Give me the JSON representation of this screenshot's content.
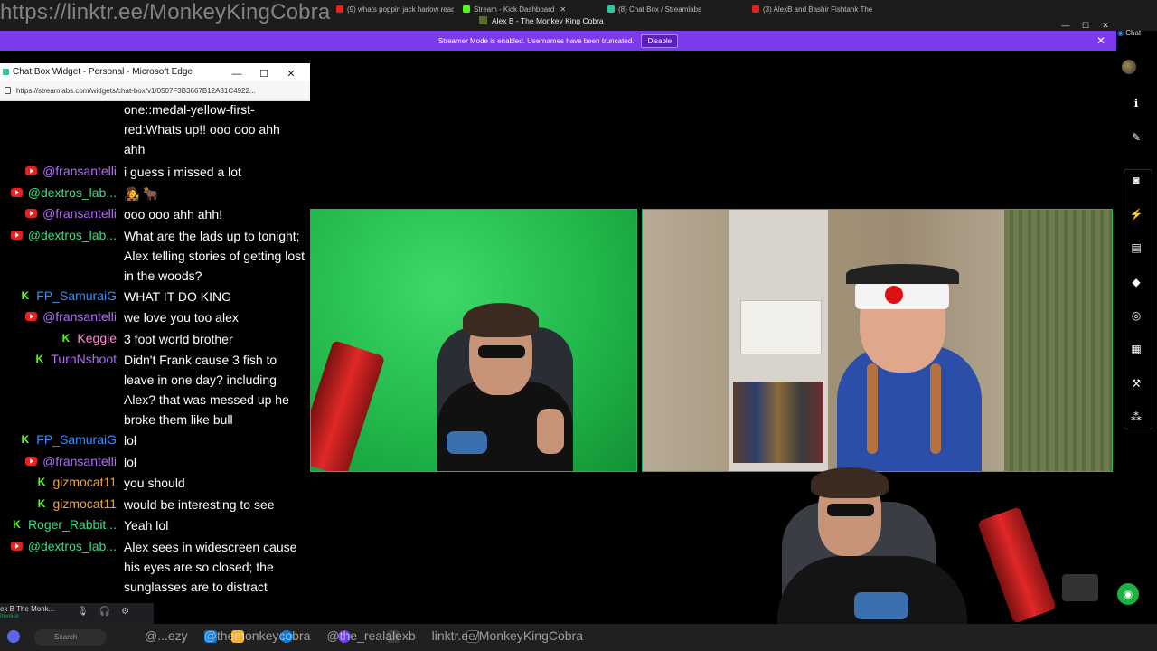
{
  "browser": {
    "overlay_link": "https://linktr.ee/MonkeyKingCobra",
    "window_title": "Alex B - The Monkey King Cobra",
    "tabs": [
      {
        "label": "(9) whats poppin jack harlow reac",
        "color": "#e52222"
      },
      {
        "label": "Stream - Kick Dashboard",
        "color": "#53fc18"
      },
      {
        "label": "(8) Chat Box / Streamlabs",
        "color": "#31c3a2"
      },
      {
        "label": "(3) AlexB and Bashir Fishtank The",
        "color": "#e52222"
      }
    ],
    "edge_chat_label": "Chat"
  },
  "banner": {
    "text": "Streamer Mode is enabled. Usernames have been truncated.",
    "disable_label": "Disable",
    "close_glyph": "✕"
  },
  "chat_window": {
    "title": "Chat Box Widget - Personal - Microsoft Edge",
    "url": "https://streamlabs.com/widgets/chat-box/v1/0507F3B3667B12A31C4922...",
    "controls": [
      "—",
      "☐",
      "✕"
    ]
  },
  "chat": {
    "messages": [
      {
        "platform": "youtube",
        "name": "",
        "name_color": "#b36bff",
        "text": "one::medal-yellow-first-red:Whats up!! ooo ooo ahh ahh"
      },
      {
        "platform": "youtube",
        "name": "@fransantelli",
        "name_color": "#b36bff",
        "text": "i guess i missed a lot"
      },
      {
        "platform": "youtube",
        "name": "@dextros_lab...",
        "name_color": "#3ddc84",
        "text": "🧑‍🎤 🐂"
      },
      {
        "platform": "youtube",
        "name": "@fransantelli",
        "name_color": "#b36bff",
        "text": "ooo ooo ahh ahh!"
      },
      {
        "platform": "youtube",
        "name": "@dextros_lab...",
        "name_color": "#3ddc84",
        "text": "What are the lads up to tonight; Alex telling stories of getting lost in the woods?"
      },
      {
        "platform": "kick",
        "name": "FP_SamuraiG",
        "name_color": "#3a8dff",
        "text": "WHAT IT DO KING"
      },
      {
        "platform": "youtube",
        "name": "@fransantelli",
        "name_color": "#b36bff",
        "text": "we love you too alex"
      },
      {
        "platform": "kick",
        "name": "Keggie",
        "name_color": "#ff8ad8",
        "text": "3 foot world brother"
      },
      {
        "platform": "kick",
        "name": "TurnNshoot",
        "name_color": "#b36bff",
        "text": "Didn't Frank cause 3 fish to leave in one day? including Alex? that was messed up he broke them like bull"
      },
      {
        "platform": "kick",
        "name": "FP_SamuraiG",
        "name_color": "#3a8dff",
        "text": "lol"
      },
      {
        "platform": "youtube",
        "name": "@fransantelli",
        "name_color": "#b36bff",
        "text": "lol"
      },
      {
        "platform": "kick",
        "name": "gizmocat11",
        "name_color": "#f2a33a",
        "text": "you should"
      },
      {
        "platform": "kick",
        "name": "gizmocat11",
        "name_color": "#f2a33a",
        "text": "would be interesting to see"
      },
      {
        "platform": "kick",
        "name": "Roger_Rabbit...",
        "name_color": "#3ddc84",
        "text": "Yeah lol"
      },
      {
        "platform": "youtube",
        "name": "@dextros_lab...",
        "name_color": "#3ddc84",
        "text": "Alex sees in widescreen cause his eyes are so closed; the sunglasses are to distract"
      }
    ]
  },
  "voice": {
    "name": "ex B The Monk...",
    "status": "In voice"
  },
  "taskbar": {
    "search_placeholder": "Search",
    "overlay_items": [
      "@...ezy",
      "@themonkeycobra",
      "@the_realalexb",
      "linktr.ee/MonkeyKingCobra"
    ]
  },
  "rail": {
    "icons": [
      "info-icon",
      "pencil-icon",
      "camera-icon",
      "bolt-icon",
      "notes-icon",
      "chat-bubble-icon",
      "broadcast-icon",
      "layers-icon",
      "wrench-icon",
      "share-icon"
    ]
  },
  "colors": {
    "banner": "#7c3aed",
    "kick_green": "#53fc18",
    "youtube_red": "#e52222",
    "green_screen": "#22b84b"
  }
}
